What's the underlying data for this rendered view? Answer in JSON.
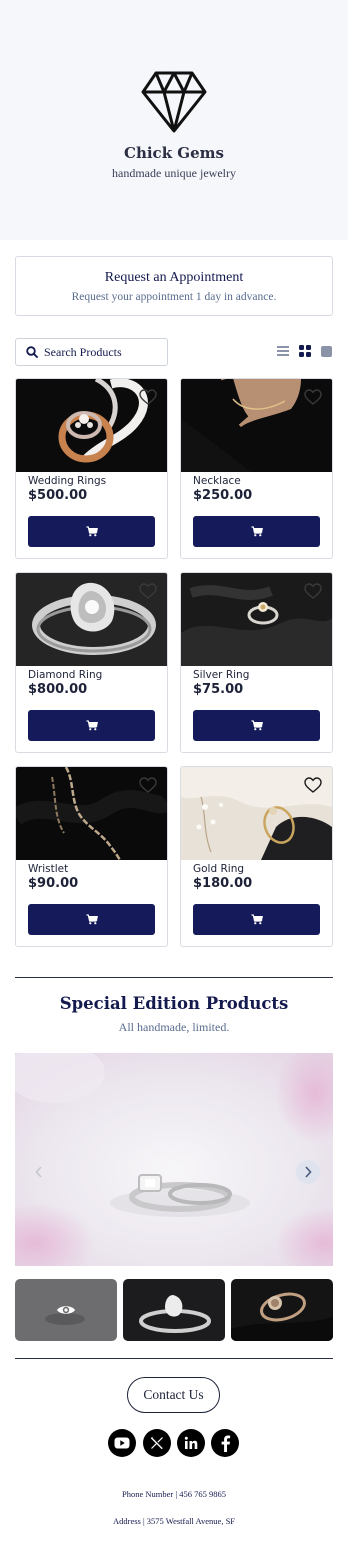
{
  "header": {
    "logo_icon": "diamond-icon",
    "brand": "Chick Gems",
    "tagline": "handmade unique jewelry"
  },
  "appointment": {
    "title": "Request an Appointment",
    "subtitle": "Request your appointment 1 day in advance."
  },
  "search": {
    "placeholder": "Search Products",
    "icon": "search-icon"
  },
  "view_toggles": [
    {
      "icon": "list-view-icon",
      "active": false
    },
    {
      "icon": "grid-view-icon",
      "active": true
    },
    {
      "icon": "large-view-icon",
      "active": false
    }
  ],
  "products": [
    {
      "name": "Wedding Rings",
      "price": "$500.00"
    },
    {
      "name": "Necklace",
      "price": "$250.00"
    },
    {
      "name": "Diamond Ring",
      "price": "$800.00"
    },
    {
      "name": "Silver Ring",
      "price": "$75.00"
    },
    {
      "name": "Wristlet",
      "price": "$90.00"
    },
    {
      "name": "Gold Ring",
      "price": "$180.00"
    }
  ],
  "special": {
    "title": "Special Edition Products",
    "subtitle": "All handmade, limited."
  },
  "contact": {
    "button_label": "Contact Us",
    "phone": "Phone Number | 456 765 9865",
    "address": "Address | 3575 Westfall Avenue, SF"
  },
  "social": [
    {
      "icon": "youtube-icon"
    },
    {
      "icon": "x-icon"
    },
    {
      "icon": "linkedin-icon"
    },
    {
      "icon": "facebook-icon"
    }
  ],
  "colors": {
    "accent": "#141a5a",
    "header_bg": "#f6f7fa",
    "text_dark": "#1d2238",
    "text_muted": "#5a6d8f"
  }
}
